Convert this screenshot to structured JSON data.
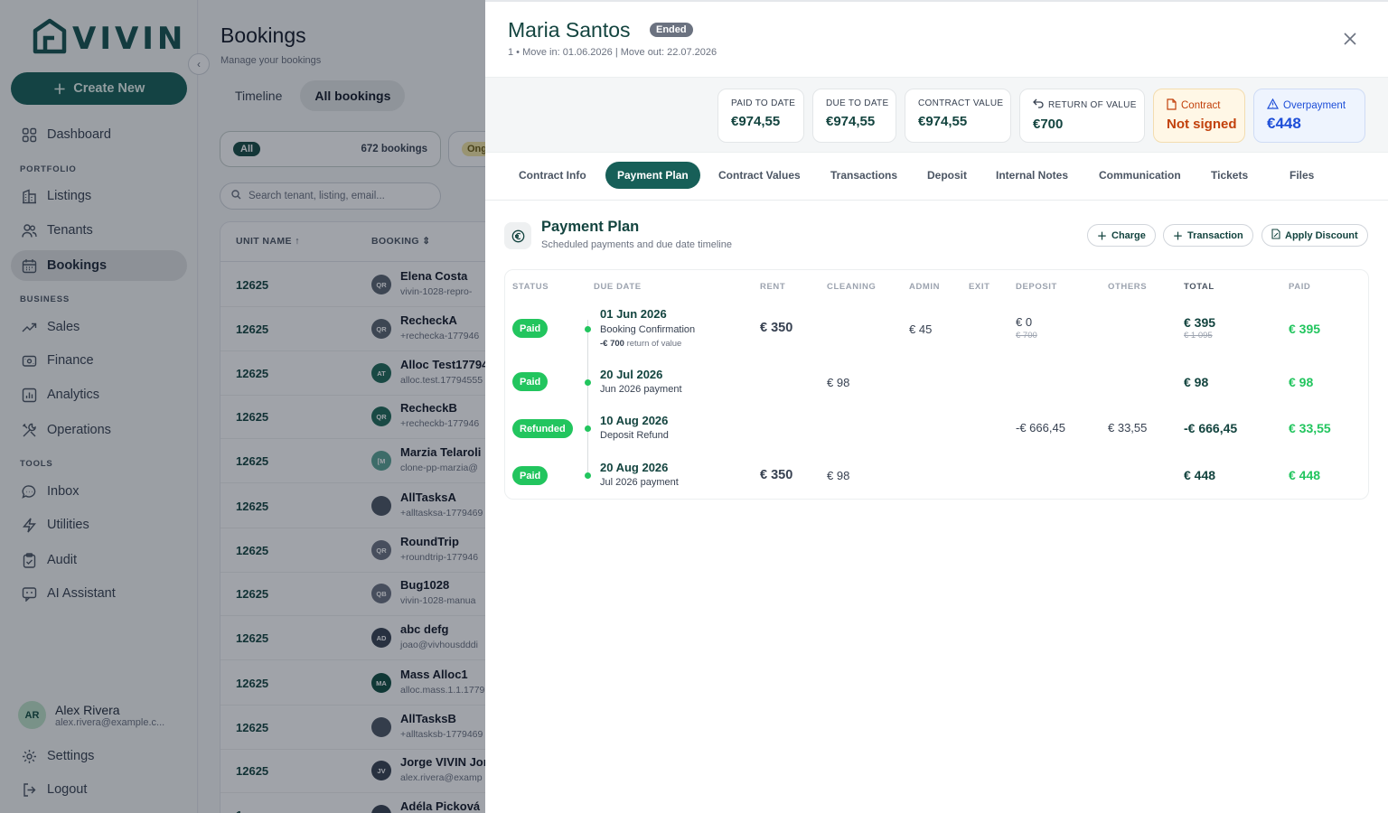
{
  "sidebar": {
    "logo_text": "VIVIN",
    "create_label": "Create New",
    "items_top": [
      {
        "label": "Dashboard",
        "icon": "grid-icon"
      }
    ],
    "portfolio_heading": "PORTFOLIO",
    "portfolio_items": [
      {
        "label": "Listings",
        "icon": "building-icon"
      },
      {
        "label": "Tenants",
        "icon": "users-icon"
      },
      {
        "label": "Bookings",
        "icon": "calendar-icon",
        "active": true
      }
    ],
    "business_heading": "BUSINESS",
    "business_items": [
      {
        "label": "Sales",
        "icon": "trend-icon"
      },
      {
        "label": "Finance",
        "icon": "wallet-icon"
      },
      {
        "label": "Analytics",
        "icon": "bar-chart-icon"
      },
      {
        "label": "Operations",
        "icon": "tools-icon"
      }
    ],
    "tools_heading": "TOOLS",
    "tools_items": [
      {
        "label": "Inbox",
        "icon": "chat-icon"
      },
      {
        "label": "Utilities",
        "icon": "bolt-icon"
      },
      {
        "label": "Audit",
        "icon": "clipboard-icon"
      },
      {
        "label": "AI Assistant",
        "icon": "chat-ai-icon"
      }
    ],
    "user": {
      "initials": "AR",
      "name": "Alex Rivera",
      "email": "alex.rivera@example.c..."
    },
    "settings_label": "Settings",
    "logout_label": "Logout"
  },
  "bookings": {
    "title": "Bookings",
    "subtitle": "Manage your bookings",
    "view_tabs": [
      "Timeline",
      "All bookings"
    ],
    "filter": {
      "label": "All",
      "count": "672 bookings",
      "next_label": "Ong"
    },
    "search_placeholder": "Search tenant, listing, email...",
    "columns": [
      "UNIT NAME",
      "BOOKING"
    ],
    "rows": [
      {
        "unit": "12625",
        "initials": "QR",
        "name": "Elena Costa",
        "sub": "vivin-1028-repro-",
        "color": "#5b6470"
      },
      {
        "unit": "12625",
        "initials": "QR",
        "name": "RecheckA",
        "sub": "+rechecka-177946",
        "color": "#5b6470"
      },
      {
        "unit": "12625",
        "initials": "AT",
        "name": "Alloc Test17794",
        "sub": "alloc.test.17794555",
        "color": "#1f6a57"
      },
      {
        "unit": "12625",
        "initials": "QR",
        "name": "RecheckB",
        "sub": "+recheckb-177946",
        "color": "#1f6a57"
      },
      {
        "unit": "12625",
        "initials": "[M",
        "name": "Marzia Telaroli",
        "sub": "clone-pp-marzia@",
        "color": "#5aa394"
      },
      {
        "unit": "12625",
        "initials": "",
        "name": "AllTasksA",
        "sub": "+alltasksa-1779469",
        "color": "#4b5563"
      },
      {
        "unit": "12625",
        "initials": "QR",
        "name": "RoundTrip",
        "sub": "+roundtrip-177946",
        "color": "#6b7280"
      },
      {
        "unit": "12625",
        "initials": "QB",
        "name": "Bug1028",
        "sub": "vivin-1028-manua",
        "color": "#6b7280"
      },
      {
        "unit": "12625",
        "initials": "AD",
        "name": "abc defg",
        "sub": "joao@vivhousdddi",
        "color": "#374151"
      },
      {
        "unit": "12625",
        "initials": "MA",
        "name": "Mass Alloc1",
        "sub": "alloc.mass.1.1.1779",
        "color": "#0f4d40"
      },
      {
        "unit": "12625",
        "initials": "",
        "name": "AllTasksB",
        "sub": "+alltasksb-1779469",
        "color": "#4b5563"
      },
      {
        "unit": "12625",
        "initials": "JV",
        "name": "Jorge VIVIN Jor",
        "sub": "alex.rivera@examp",
        "color": "#374151"
      },
      {
        "unit": "1",
        "initials": "",
        "name": "Adéla Picková",
        "sub": "",
        "color": "#374151"
      }
    ]
  },
  "drawer": {
    "tenant_name": "Maria Santos",
    "status_badge": "Ended",
    "meta": "1 • Move in: 01.06.2026 | Move out: 22.07.2026",
    "stats": [
      {
        "label": "PAID TO DATE",
        "value": "€974,55"
      },
      {
        "label": "DUE TO DATE",
        "value": "€974,55"
      },
      {
        "label": "CONTRACT VALUE",
        "value": "€974,55"
      },
      {
        "label": "RETURN OF VALUE",
        "value": "€700",
        "icon": "return-arrow-icon"
      },
      {
        "label": "Contract",
        "value": "Not signed",
        "icon": "document-icon",
        "color": "#c2410c"
      },
      {
        "label": "Overpayment",
        "value": "€448",
        "icon": "warning-icon",
        "color": "#1d4ed8"
      }
    ],
    "tabs": [
      "Contract Info",
      "Payment Plan",
      "Contract Values",
      "Transactions",
      "Deposit",
      "Internal Notes",
      "Communication",
      "Tickets",
      "Files"
    ],
    "active_tab": "Payment Plan",
    "payment_plan": {
      "title": "Payment Plan",
      "subtitle": "Scheduled payments and due date timeline",
      "actions": [
        "Charge",
        "Transaction",
        "Apply Discount"
      ],
      "columns": [
        "STATUS",
        "DUE DATE",
        "RENT",
        "CLEANING",
        "ADMIN",
        "EXIT",
        "DEPOSIT",
        "OTHERS",
        "TOTAL",
        "PAID"
      ],
      "rows": [
        {
          "status": "Paid",
          "date": "01 Jun 2026",
          "desc": "Booking Confirmation",
          "note_amount": "-€ 700",
          "note_text": "return of value",
          "rent": "€ 350",
          "cleaning": "",
          "admin": "€ 45",
          "exit": "",
          "deposit": "€ 0",
          "deposit_old": "€ 700",
          "others": "",
          "total": "€ 395",
          "total_old": "€ 1 095",
          "paid": "€ 395"
        },
        {
          "status": "Paid",
          "date": "20 Jul 2026",
          "desc": "Jun 2026 payment",
          "note_amount": "",
          "note_text": "",
          "rent": "",
          "cleaning": "€ 98",
          "admin": "",
          "exit": "",
          "deposit": "",
          "deposit_old": "",
          "others": "",
          "total": "€ 98",
          "total_old": "",
          "paid": "€ 98"
        },
        {
          "status": "Refunded",
          "date": "10 Aug 2026",
          "desc": "Deposit Refund",
          "note_amount": "",
          "note_text": "",
          "rent": "",
          "cleaning": "",
          "admin": "",
          "exit": "",
          "deposit": "-€ 666,45",
          "deposit_old": "",
          "others": "€ 33,55",
          "total": "-€ 666,45",
          "total_old": "",
          "paid": "€ 33,55"
        },
        {
          "status": "Paid",
          "date": "20 Aug 2026",
          "desc": "Jul 2026 payment",
          "note_amount": "",
          "note_text": "",
          "rent": "€ 350",
          "cleaning": "€ 98",
          "admin": "",
          "exit": "",
          "deposit": "",
          "deposit_old": "",
          "others": "",
          "total": "€ 448",
          "total_old": "",
          "paid": "€ 448"
        }
      ]
    }
  },
  "colors": {
    "brand": "#175f58",
    "paid_green": "#22c55e",
    "warn": "#c2410c",
    "info": "#1d4ed8"
  }
}
